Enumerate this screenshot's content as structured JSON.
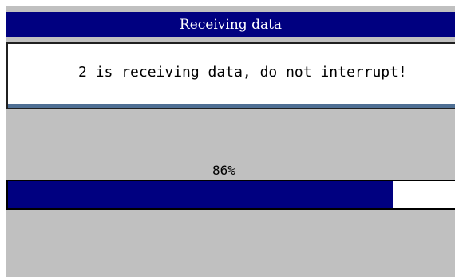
{
  "dialog": {
    "title": "Receiving data",
    "message": "2 is receiving data, do not interrupt!"
  },
  "progress": {
    "label": "86%",
    "fraction": 0.86
  },
  "colors": {
    "title_bar": "#000080",
    "progress_fill": "#000080",
    "dialog_background": "#c0c0c0",
    "message_underline": "#4f6f94"
  }
}
